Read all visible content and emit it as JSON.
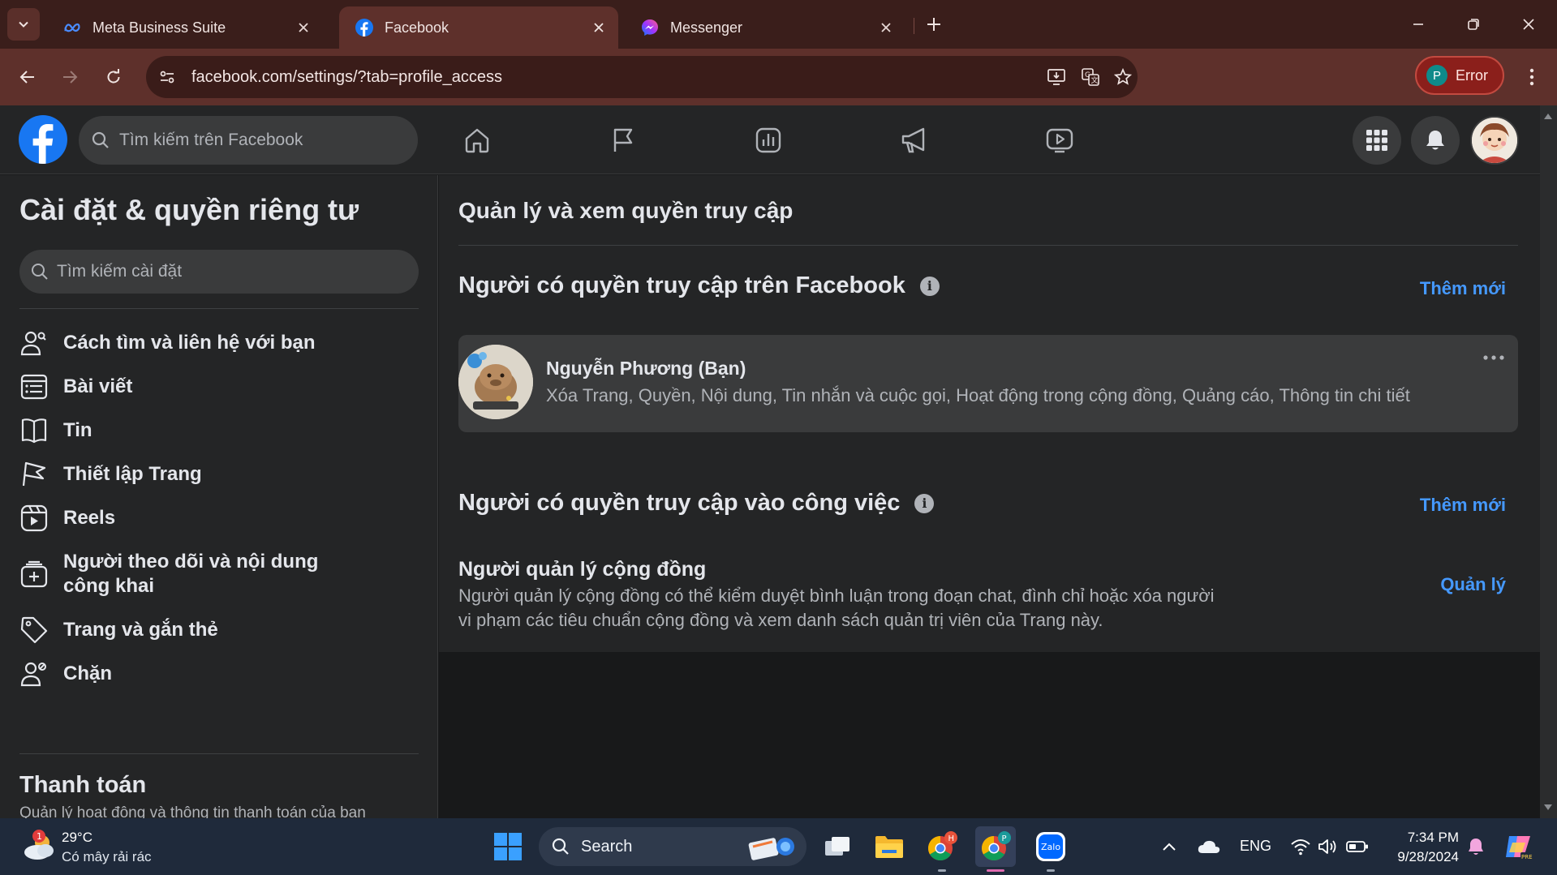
{
  "browser": {
    "tabs": [
      {
        "title": "Meta Business Suite",
        "icon": "meta-icon",
        "active": false
      },
      {
        "title": "Facebook",
        "icon": "facebook-icon",
        "active": true
      },
      {
        "title": "Messenger",
        "icon": "messenger-icon",
        "active": false
      }
    ],
    "url": "facebook.com/settings/?tab=profile_access",
    "profile": {
      "initial": "P",
      "status": "Error"
    }
  },
  "header": {
    "search_placeholder": "Tìm kiếm trên Facebook",
    "nav": [
      "home-icon",
      "flag-icon",
      "insights-icon",
      "megaphone-icon",
      "video-icon"
    ]
  },
  "sidebar": {
    "title": "Cài đặt & quyền riêng tư",
    "search_placeholder": "Tìm kiếm cài đặt",
    "items": [
      {
        "label": "Cách tìm và liên hệ với bạn",
        "icon": "people-search-icon"
      },
      {
        "label": "Bài viết",
        "icon": "posts-icon"
      },
      {
        "label": "Tin",
        "icon": "story-icon"
      },
      {
        "label": "Thiết lập Trang",
        "icon": "flag-icon"
      },
      {
        "label": "Reels",
        "icon": "reels-icon"
      },
      {
        "label": "Người theo dõi và nội dung công khai",
        "icon": "followers-icon"
      },
      {
        "label": "Trang và gắn thẻ",
        "icon": "tag-icon"
      },
      {
        "label": "Chặn",
        "icon": "block-user-icon"
      }
    ],
    "section": {
      "title": "Thanh toán",
      "subtitle": "Quản lý hoạt động và thông tin thanh toán của bạn"
    }
  },
  "main": {
    "title": "Quản lý và xem quyền truy cập",
    "facebook_access": {
      "title": "Người có quyền truy cập trên Facebook",
      "add_label": "Thêm mới",
      "person": {
        "name": "Nguyễn Phương (Bạn)",
        "permissions": "Xóa Trang, Quyền, Nội dung, Tin nhắn và cuộc gọi, Hoạt động trong cộng đồng, Quảng cáo, Thông tin chi tiết"
      }
    },
    "task_access": {
      "title": "Người có quyền truy cập vào công việc",
      "add_label": "Thêm mới",
      "role": {
        "title": "Người quản lý cộng đồng",
        "description": "Người quản lý cộng đồng có thể kiểm duyệt bình luận trong đoạn chat, đình chỉ hoặc xóa người vi phạm các tiêu chuẩn cộng đồng và xem danh sách quản trị viên của Trang này.",
        "manage_label": "Quản lý"
      }
    }
  },
  "taskbar": {
    "weather": {
      "temp": "29°C",
      "desc": "Có mây rải rác",
      "badge": "1"
    },
    "search_placeholder": "Search",
    "language": "ENG",
    "time": "7:34 PM",
    "date": "9/28/2024",
    "chrome_badges": [
      "H",
      "P"
    ]
  },
  "colors": {
    "accent_link": "#4599ff",
    "facebook_blue": "#1877f2",
    "browser_frame": "#5e302b"
  }
}
